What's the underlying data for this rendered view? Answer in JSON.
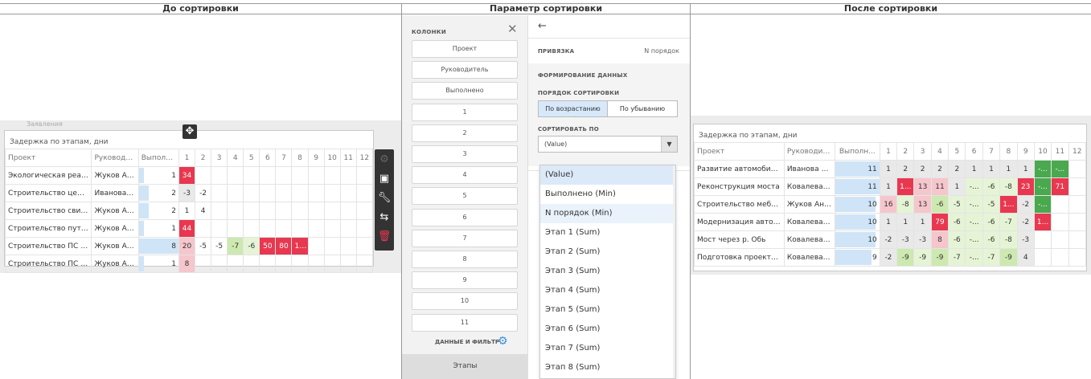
{
  "headers": {
    "before": "До сортировки",
    "param": "Параметр сортировки",
    "after": "После сортировки"
  },
  "left": {
    "bg_label": "Заявления",
    "title": "Задержка по этапам, дни",
    "cols": [
      "Проект",
      "Руководите...",
      "Выполн...",
      "1",
      "2",
      "3",
      "4",
      "5",
      "6",
      "7",
      "8",
      "9",
      "10",
      "11",
      "12"
    ],
    "rows": [
      {
        "p": "Экологическая реабил...",
        "r": "Жуков Андр...",
        "v": "1",
        "bar": 0.125,
        "c": [
          {
            "t": "34",
            "k": "r1"
          }
        ]
      },
      {
        "p": "Строительство цемент...",
        "r": "Иванова Ан...",
        "v": "2",
        "bar": 0.25,
        "c": [
          {
            "t": "-3",
            "k": "gy"
          },
          {
            "t": "-2",
            "k": ""
          }
        ]
      },
      {
        "p": "Строительство свинок...",
        "r": "Жуков Андр...",
        "v": "2",
        "bar": 0.25,
        "c": [
          {
            "t": "1",
            "k": ""
          },
          {
            "t": "4",
            "k": ""
          }
        ]
      },
      {
        "p": "Строительство путепро...",
        "r": "Жуков Андр...",
        "v": "1",
        "bar": 0.125,
        "c": [
          {
            "t": "44",
            "k": "r1"
          }
        ]
      },
      {
        "p": "Строительство ПС 220 ...",
        "r": "Жуков Андр...",
        "v": "8",
        "bar": 1.0,
        "c": [
          {
            "t": "20",
            "k": "r2"
          },
          {
            "t": "-5",
            "k": ""
          },
          {
            "t": "-5",
            "k": ""
          },
          {
            "t": "-7",
            "k": "g1"
          },
          {
            "t": "-6",
            "k": "g2"
          },
          {
            "t": "50",
            "k": "r1"
          },
          {
            "t": "80",
            "k": "r1"
          },
          {
            "t": "1...",
            "k": "r1"
          }
        ]
      },
      {
        "p": "Строительство ПС 220 ...",
        "r": "Жуков Андр...",
        "v": "1",
        "bar": 0.125,
        "c": [
          {
            "t": "8",
            "k": "r2"
          }
        ]
      }
    ],
    "toolbar_icons": [
      "gear-icon",
      "layout-icon",
      "wrench-icon",
      "sort-icon",
      "trash-icon"
    ],
    "move_icon": "move-icon"
  },
  "columns_panel": {
    "header": "КОЛОНКИ",
    "close": "✕",
    "items": [
      "Проект",
      "Руководитель",
      "Выполнено",
      "1",
      "2",
      "3",
      "4",
      "5",
      "6",
      "7",
      "8",
      "9",
      "10",
      "11"
    ],
    "data_filter": "ДАННЫЕ И ФИЛЬТР",
    "stages_tab": "Этапы"
  },
  "settings": {
    "back": "←",
    "binding_label": "ПРИВЯЗКА",
    "binding_value": "N порядок",
    "data_form": "ФОРМИРОВАНИЕ ДАННЫХ",
    "sort_order": "ПОРЯДОК СОРТИРОВКИ",
    "asc": "По возрастанию",
    "desc": "По убыванию",
    "sort_by": "СОРТИРОВАТЬ ПО",
    "select_value": "(Value)",
    "options": [
      "(Value)",
      "Выполнено (Min)",
      "N порядок (Min)",
      "Этап 1 (Sum)",
      "Этап 2 (Sum)",
      "Этап 3 (Sum)",
      "Этап 4 (Sum)",
      "Этап 5 (Sum)",
      "Этап 6 (Sum)",
      "Этап 7 (Sum)",
      "Этап 8 (Sum)"
    ]
  },
  "right": {
    "title": "Задержка по этапам, дни",
    "cols": [
      "Проект",
      "Руководите...",
      "Выполн...",
      "1",
      "2",
      "3",
      "4",
      "5",
      "6",
      "7",
      "8",
      "9",
      "10",
      "11",
      "12"
    ],
    "rows": [
      {
        "p": "Развитие автомобильн...",
        "r": "Иванова Ан...",
        "v": "11",
        "bar": 1.0,
        "c": [
          {
            "t": "1",
            "k": "gy"
          },
          {
            "t": "2",
            "k": "gy"
          },
          {
            "t": "2",
            "k": "gy"
          },
          {
            "t": "2",
            "k": "gy"
          },
          {
            "t": "2",
            "k": "gy"
          },
          {
            "t": "1",
            "k": "gy"
          },
          {
            "t": "1",
            "k": "gy"
          },
          {
            "t": "1",
            "k": "gy"
          },
          {
            "t": "1",
            "k": "gy"
          },
          {
            "t": "-...",
            "k": "gg"
          },
          {
            "t": "-...",
            "k": "gg"
          }
        ]
      },
      {
        "p": "Реконструкция моста",
        "r": "Ковалева С...",
        "v": "11",
        "bar": 1.0,
        "c": [
          {
            "t": "1",
            "k": "gy"
          },
          {
            "t": "1...",
            "k": "r1"
          },
          {
            "t": "13",
            "k": "r2"
          },
          {
            "t": "11",
            "k": "r2"
          },
          {
            "t": "1",
            "k": "gy"
          },
          {
            "t": "-...",
            "k": "g2"
          },
          {
            "t": "-6",
            "k": "g2"
          },
          {
            "t": "-8",
            "k": "g2"
          },
          {
            "t": "23",
            "k": "r1"
          },
          {
            "t": "-...",
            "k": "gg"
          },
          {
            "t": "71",
            "k": "r1"
          }
        ]
      },
      {
        "p": "Строительство мебель...",
        "r": "Жуков Андр...",
        "v": "10",
        "bar": 0.91,
        "c": [
          {
            "t": "16",
            "k": "r2"
          },
          {
            "t": "-8",
            "k": "g2"
          },
          {
            "t": "13",
            "k": "r2"
          },
          {
            "t": "-6",
            "k": "g1"
          },
          {
            "t": "-5",
            "k": "g2"
          },
          {
            "t": "-...",
            "k": "g2"
          },
          {
            "t": "-5",
            "k": "g2"
          },
          {
            "t": "1...",
            "k": "r1"
          },
          {
            "t": "-2",
            "k": "gy"
          },
          {
            "t": "-...",
            "k": "gg"
          }
        ]
      },
      {
        "p": "Модернизация автопа...",
        "r": "Ковалева С...",
        "v": "10",
        "bar": 0.91,
        "c": [
          {
            "t": "1",
            "k": "gy"
          },
          {
            "t": "1",
            "k": "gy"
          },
          {
            "t": "1",
            "k": "gy"
          },
          {
            "t": "79",
            "k": "r1"
          },
          {
            "t": "-6",
            "k": "g2"
          },
          {
            "t": "-...",
            "k": "g2"
          },
          {
            "t": "-6",
            "k": "g2"
          },
          {
            "t": "-7",
            "k": "g2"
          },
          {
            "t": "-2",
            "k": "gy"
          },
          {
            "t": "1...",
            "k": "r1"
          }
        ]
      },
      {
        "p": "Мост через р. Обь",
        "r": "Ковалева С...",
        "v": "10",
        "bar": 0.91,
        "c": [
          {
            "t": "-2",
            "k": "gy"
          },
          {
            "t": "-3",
            "k": "gy"
          },
          {
            "t": "-3",
            "k": "gy"
          },
          {
            "t": "8",
            "k": "r2"
          },
          {
            "t": "-6",
            "k": "g2"
          },
          {
            "t": "-...",
            "k": "g2"
          },
          {
            "t": "-6",
            "k": "g2"
          },
          {
            "t": "-8",
            "k": "g2"
          },
          {
            "t": "-3",
            "k": "gy"
          }
        ]
      },
      {
        "p": "Подготовка проекта \"м...",
        "r": "Ковалева С...",
        "v": "9",
        "bar": 0.82,
        "c": [
          {
            "t": "-2",
            "k": "gy"
          },
          {
            "t": "-9",
            "k": "g1"
          },
          {
            "t": "-9",
            "k": "g2"
          },
          {
            "t": "-9",
            "k": "g1"
          },
          {
            "t": "-7",
            "k": "g2"
          },
          {
            "t": "-...",
            "k": "g2"
          },
          {
            "t": "-7",
            "k": "g2"
          },
          {
            "t": "-9",
            "k": "g1"
          },
          {
            "t": "4",
            "k": "gy"
          }
        ]
      }
    ]
  },
  "colors": {
    "accent_blue": "#3a8fd9",
    "red_strong": "#e8384f",
    "red_light": "#f5c6cc",
    "green_strong": "#4aa84f",
    "green_light": "#cde9b0",
    "progress_bar": "#cfe4f7"
  }
}
